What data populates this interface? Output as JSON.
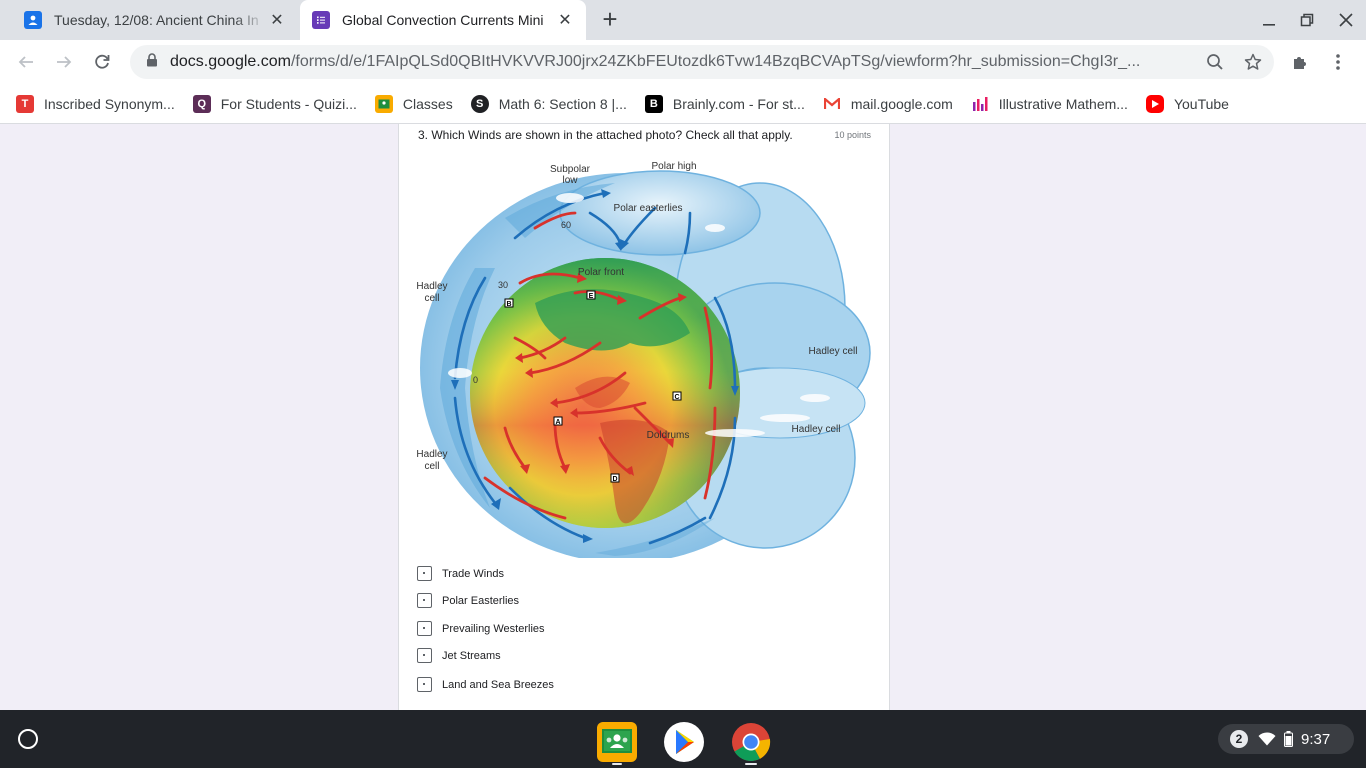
{
  "browser": {
    "tabs": [
      {
        "title": "Tuesday, 12/08: Ancient China In"
      },
      {
        "title": "Global Convection Currents Mini"
      }
    ],
    "url_host": "docs.google.com",
    "url_path": "/forms/d/e/1FAIpQLSd0QBItHVKVVRJ00jrx24ZKbFEUtozdk6Tvw14BzqBCVApTSg/viewform?hr_submission=ChgI3r_...",
    "bookmarks": [
      {
        "label": "Inscribed Synonym...",
        "color": "#e53935"
      },
      {
        "label": "For Students - Quizi...",
        "color": "#5c2d57"
      },
      {
        "label": "Classes",
        "color": "#f9ab00"
      },
      {
        "label": "Math 6: Section 8 |...",
        "color": "#202124"
      },
      {
        "label": "Brainly.com - For st...",
        "color": "#000000"
      },
      {
        "label": "mail.google.com",
        "color": "#ffffff"
      },
      {
        "label": "Illustrative Mathem...",
        "color": "#8e24aa"
      },
      {
        "label": "YouTube",
        "color": "#ff0000"
      }
    ]
  },
  "form": {
    "question": "3. Which Winds are shown in the attached photo? Check all that apply.",
    "points": "10 points",
    "options": [
      "Trade Winds",
      "Polar Easterlies",
      "Prevailing Westerlies",
      "Jet Streams",
      "Land and Sea Breezes"
    ],
    "figure_labels": {
      "subpolar": "Subpolar",
      "low": "low",
      "polar_high": "Polar high",
      "polar_easterlies": "Polar easterlies",
      "lat60": "60",
      "polar_front": "Polar front",
      "lat30": "30",
      "hadley": "Hadley",
      "cell": "cell",
      "hadley_cell": "Hadley cell",
      "lat0": "0",
      "doldrums": "Doldrums",
      "mark_a": "A",
      "mark_b": "B",
      "mark_c": "C",
      "mark_d": "D",
      "mark_e": "E"
    }
  },
  "shelf": {
    "notification_count": "2",
    "time": "9:37"
  }
}
